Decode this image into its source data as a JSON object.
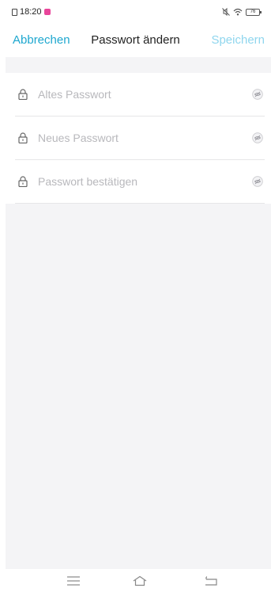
{
  "status_bar": {
    "time": "18:20",
    "battery": "76"
  },
  "nav": {
    "cancel_label": "Abbrechen",
    "title": "Passwort ändern",
    "save_label": "Speichern"
  },
  "form": {
    "fields": [
      {
        "placeholder": "Altes Passwort"
      },
      {
        "placeholder": "Neues Passwort"
      },
      {
        "placeholder": "Passwort bestätigen"
      }
    ]
  },
  "colors": {
    "accent": "#1ea7cf",
    "accent_disabled": "#8fd6ee",
    "background": "#f4f4f6"
  },
  "icons": {
    "field_leading": "lock-icon",
    "field_trailing": "eye-hidden-icon",
    "system_nav": [
      "menu-icon",
      "home-icon",
      "back-icon"
    ]
  }
}
